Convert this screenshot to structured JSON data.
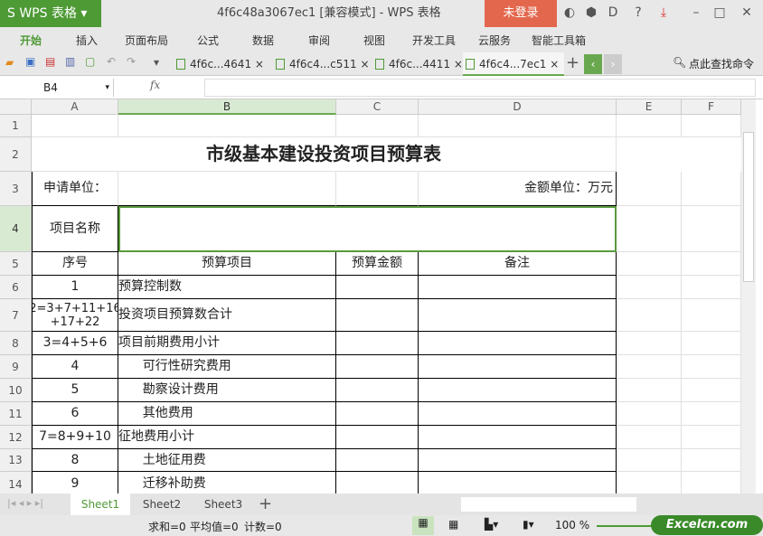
{
  "app": {
    "logo": "S WPS 表格",
    "title": "4f6c48a3067ec1 [兼容模式] - WPS 表格",
    "login": "未登录"
  },
  "menu": [
    "开始",
    "插入",
    "页面布局",
    "公式",
    "数据",
    "审阅",
    "视图",
    "开发工具",
    "云服务",
    "智能工具箱"
  ],
  "doc_tabs": [
    "4f6c...4641",
    "4f6c4...c511",
    "4f6c...4411",
    "4f6c4...7ec1"
  ],
  "active_doc_tab": 3,
  "search_command": "点此查找命令",
  "name_box": "B4",
  "fx_label": "fx",
  "columns": [
    "A",
    "B",
    "C",
    "D",
    "E",
    "F"
  ],
  "selected_column": "B",
  "rows": [
    {
      "n": "1",
      "cells": [
        "",
        "",
        "",
        ""
      ]
    },
    {
      "n": "2",
      "title": "市级基本建设投资项目预算表"
    },
    {
      "n": "3",
      "cells": [
        "申请单位：",
        "",
        "",
        "金额单位：万元"
      ]
    },
    {
      "n": "4",
      "cells": [
        "项目名称",
        "",
        "",
        ""
      ]
    },
    {
      "n": "5",
      "cells": [
        "序号",
        "预算项目",
        "预算金额",
        "备注"
      ]
    },
    {
      "n": "6",
      "cells": [
        "1",
        "预算控制数",
        "",
        ""
      ]
    },
    {
      "n": "7",
      "cells": [
        "2=3+7+11+16\n+17+22",
        "投资项目预算数合计",
        "",
        ""
      ]
    },
    {
      "n": "8",
      "cells": [
        "3=4+5+6",
        "项目前期费用小计",
        "",
        ""
      ]
    },
    {
      "n": "9",
      "cells": [
        "4",
        "      可行性研究费用",
        "",
        ""
      ]
    },
    {
      "n": "10",
      "cells": [
        "5",
        "      勘察设计费用",
        "",
        ""
      ]
    },
    {
      "n": "11",
      "cells": [
        "6",
        "      其他费用",
        "",
        ""
      ]
    },
    {
      "n": "12",
      "cells": [
        "7=8+9+10",
        "征地费用小计",
        "",
        ""
      ]
    },
    {
      "n": "13",
      "cells": [
        "8",
        "      土地征用费",
        "",
        ""
      ]
    },
    {
      "n": "14",
      "cells": [
        "9",
        "      迁移补助费",
        "",
        ""
      ]
    }
  ],
  "sheets": [
    "Sheet1",
    "Sheet2",
    "Sheet3"
  ],
  "status": {
    "sum": "求和=0",
    "avg": "平均值=0",
    "count": "计数=0",
    "zoom": "100 %"
  },
  "watermark": "Excelcn.com"
}
